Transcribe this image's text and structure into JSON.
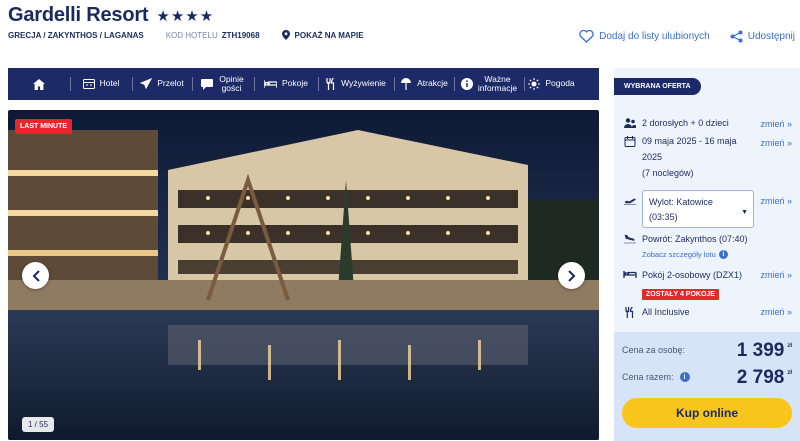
{
  "header": {
    "hotel_name": "Gardelli Resort",
    "stars": "★★★★",
    "breadcrumb": "GRECJA / ZAKYNTHOS / LAGANAS",
    "code_label": "KOD HOTELU",
    "code_value": "ZTH19068",
    "map_link": "POKAŻ NA MAPIE",
    "favorite_label": "Dodaj do listy ulubionych",
    "share_label": "Udostępnij"
  },
  "nav": {
    "items": [
      {
        "label": "",
        "icon": "home-icon"
      },
      {
        "label": "Hotel",
        "icon": "hotel-icon"
      },
      {
        "label": "Przelot",
        "icon": "plane-icon"
      },
      {
        "label": "Opinie gości",
        "icon": "chat-icon"
      },
      {
        "label": "Pokoje",
        "icon": "bed-icon"
      },
      {
        "label": "Wyżywienie",
        "icon": "cutlery-icon"
      },
      {
        "label": "Atrakcje",
        "icon": "beach-umbrella-icon"
      },
      {
        "label": "Ważne informacje",
        "icon": "info-icon"
      },
      {
        "label": "Pogoda",
        "icon": "sun-icon"
      }
    ]
  },
  "gallery": {
    "badge": "LAST MINUTE",
    "counter": "1 / 55",
    "progress": 0.018
  },
  "offer": {
    "tag": "WYBRANA OFERTA",
    "change_label": "zmień »",
    "travelers": "2 dorosłych + 0 dzieci",
    "dates_line1": "09 maja 2025 - 16 maja",
    "dates_line2": "2025",
    "nights": "(7 noclegów)",
    "departure_line1": "Wylot: Katowice",
    "departure_line2": "(03:35)",
    "return": "Powrót: Zakynthos (07:40)",
    "flight_details": "Zobacz szczegóły lotu",
    "room": "Pokój 2-osobowy (DZX1)",
    "rooms_left": "ZOSTAŁY 4 POKOJE",
    "board": "All Inclusive"
  },
  "price": {
    "per_person_label": "Cena za osobę:",
    "per_person_value": "1 399",
    "total_label": "Cena razem:",
    "total_value": "2 798",
    "currency": "zł",
    "buy_label": "Kup online"
  },
  "colors": {
    "navy": "#1c2a68",
    "link_blue": "#3a6fd0",
    "red": "#e3282e",
    "yellow": "#f7c51b",
    "panel_bg": "#eef4fc",
    "price_bg": "#d7e4f7"
  }
}
